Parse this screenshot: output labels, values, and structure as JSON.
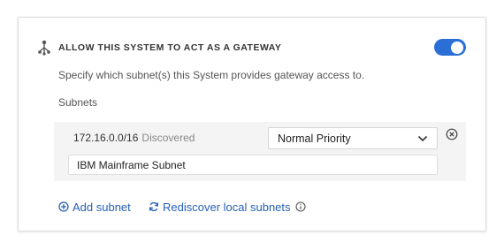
{
  "section": {
    "title": "ALLOW THIS SYSTEM TO ACT AS A GATEWAY",
    "icon": "gateway-icon",
    "toggle_on": true,
    "description": "Specify which subnet(s) this System provides gateway access to.",
    "subnets_label": "Subnets"
  },
  "subnets": [
    {
      "address": "172.16.0.0/16",
      "status": "Discovered",
      "priority": "Normal Priority",
      "name": "IBM Mainframe Subnet"
    }
  ],
  "actions": {
    "add_subnet": "Add subnet",
    "rediscover": "Rediscover local subnets"
  },
  "colors": {
    "accent": "#2b6fd6",
    "link": "#2660b6"
  }
}
